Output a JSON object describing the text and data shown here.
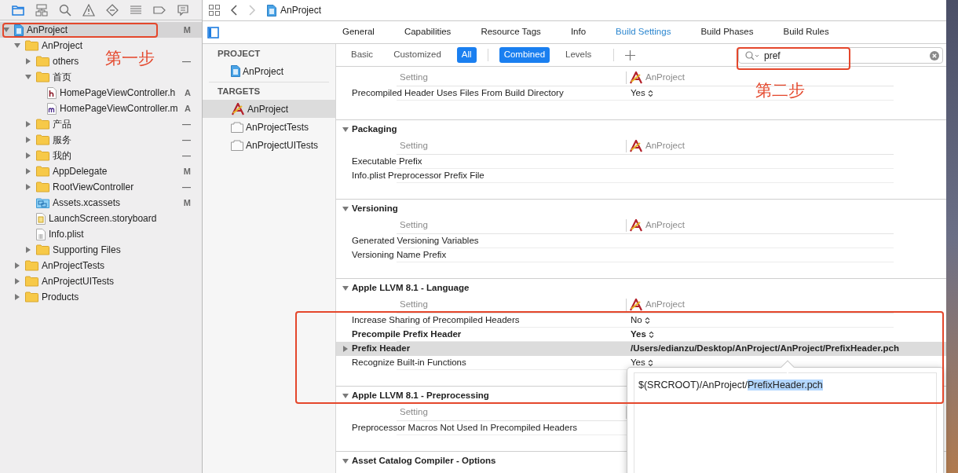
{
  "navigator_tabs": [
    {
      "kind": "folder",
      "selected": true
    },
    {
      "kind": "hierarchy",
      "selected": false
    },
    {
      "kind": "search",
      "selected": false
    },
    {
      "kind": "warning",
      "selected": false
    },
    {
      "kind": "diamond",
      "selected": false
    },
    {
      "kind": "list",
      "selected": false
    },
    {
      "kind": "tag",
      "selected": false
    },
    {
      "kind": "comment",
      "selected": false
    }
  ],
  "file_tree": [
    {
      "label": "AnProject",
      "kind": "project",
      "expanded": true,
      "selected": true,
      "badge": "M",
      "children": [
        {
          "label": "AnProject",
          "kind": "folder",
          "expanded": true,
          "selected": false,
          "children": [
            {
              "label": "others",
              "kind": "folder",
              "expanded": false,
              "selected": false,
              "badge": "—"
            },
            {
              "label": "首页",
              "kind": "folder",
              "expanded": true,
              "selected": false,
              "children": [
                {
                  "label": "HomePageViewController.h",
                  "kind": "header",
                  "selected": false,
                  "badge": "A"
                },
                {
                  "label": "HomePageViewController.m",
                  "kind": "source",
                  "selected": false,
                  "badge": "A"
                }
              ]
            },
            {
              "label": "产品",
              "kind": "folder",
              "expanded": false,
              "selected": false,
              "badge": "—"
            },
            {
              "label": "服务",
              "kind": "folder",
              "expanded": false,
              "selected": false,
              "badge": "—"
            },
            {
              "label": "我的",
              "kind": "folder",
              "expanded": false,
              "selected": false,
              "badge": "—"
            },
            {
              "label": "AppDelegate",
              "kind": "folder",
              "expanded": false,
              "selected": false,
              "badge": "M"
            },
            {
              "label": "RootViewController",
              "kind": "folder",
              "expanded": false,
              "selected": false,
              "badge": "—"
            },
            {
              "label": "Assets.xcassets",
              "kind": "assets",
              "selected": false,
              "badge": "M"
            },
            {
              "label": "LaunchScreen.storyboard",
              "kind": "storyboard",
              "selected": false
            },
            {
              "label": "Info.plist",
              "kind": "plist",
              "selected": false
            },
            {
              "label": "Supporting Files",
              "kind": "folder",
              "expanded": false,
              "selected": false
            }
          ]
        },
        {
          "label": "AnProjectTests",
          "kind": "folder",
          "expanded": false,
          "selected": false
        },
        {
          "label": "AnProjectUITests",
          "kind": "folder",
          "expanded": false,
          "selected": false
        },
        {
          "label": "Products",
          "kind": "folder",
          "expanded": false,
          "selected": false
        }
      ]
    }
  ],
  "jump_bar": {
    "nav_buttons": [
      {
        "kind": "back",
        "disabled": false
      },
      {
        "kind": "forward",
        "disabled": true
      }
    ],
    "breadcrumb": "AnProject"
  },
  "tabs": [
    {
      "label": "General",
      "selected": false
    },
    {
      "label": "Capabilities",
      "selected": false
    },
    {
      "label": "Resource Tags",
      "selected": false
    },
    {
      "label": "Info",
      "selected": false
    },
    {
      "label": "Build Settings",
      "selected": true
    },
    {
      "label": "Build Phases",
      "selected": false
    },
    {
      "label": "Build Rules",
      "selected": false
    }
  ],
  "targets_panel": [
    {
      "heading": "PROJECT",
      "items": [
        {
          "label": "AnProject",
          "kind": "project",
          "selected": false
        }
      ]
    },
    {
      "heading": "TARGETS",
      "items": [
        {
          "label": "AnProject",
          "kind": "app",
          "selected": true
        },
        {
          "label": "AnProjectTests",
          "kind": "bundle",
          "selected": false
        },
        {
          "label": "AnProjectUITests",
          "kind": "bundle",
          "selected": false
        }
      ]
    }
  ],
  "filter_bar": {
    "scope": [
      {
        "label": "Basic",
        "selected": false
      },
      {
        "label": "Customized",
        "selected": false
      },
      {
        "label": "All",
        "selected": true
      }
    ],
    "view": [
      {
        "label": "Combined",
        "selected": true
      },
      {
        "label": "Levels",
        "selected": false
      }
    ],
    "search": {
      "value": "pref"
    }
  },
  "settings_sections": [
    {
      "column_header": "Setting",
      "target": "AnProject",
      "rows": [
        {
          "name": "Precompiled Header Uses Files From Build Directory",
          "value": "Yes",
          "stepper": true,
          "customized": false,
          "selected": false
        }
      ]
    },
    {
      "title": "Packaging",
      "expanded": true,
      "column_header": "Setting",
      "target": "AnProject",
      "rows": [
        {
          "name": "Executable Prefix",
          "customized": false,
          "selected": false
        },
        {
          "name": "Info.plist Preprocessor Prefix File",
          "customized": false,
          "selected": false
        }
      ]
    },
    {
      "title": "Versioning",
      "expanded": true,
      "column_header": "Setting",
      "target": "AnProject",
      "rows": [
        {
          "name": "Generated Versioning Variables",
          "customized": false,
          "selected": false
        },
        {
          "name": "Versioning Name Prefix",
          "customized": false,
          "selected": false
        }
      ]
    },
    {
      "title": "Apple LLVM 8.1 - Language",
      "expanded": true,
      "column_header": "Setting",
      "target": "AnProject",
      "rows": [
        {
          "name": "Increase Sharing of Precompiled Headers",
          "value": "No",
          "stepper": true,
          "customized": false,
          "selected": false
        },
        {
          "name": "Precompile Prefix Header",
          "value": "Yes",
          "stepper": true,
          "customized": true,
          "selected": false
        },
        {
          "name": "Prefix Header",
          "value": "/Users/edianzu/Desktop/AnProject/AnProject/PrefixHeader.pch",
          "stepper": false,
          "customized": true,
          "selected": true,
          "expanded": false
        },
        {
          "name": "Recognize Built-in Functions",
          "value": "Yes",
          "stepper": true,
          "customized": false,
          "selected": false
        }
      ]
    },
    {
      "title": "Apple LLVM 8.1 - Preprocessing",
      "expanded": true,
      "column_header": "Setting",
      "rows": [
        {
          "name": "Preprocessor Macros Not Used In Precompiled Headers",
          "customized": false,
          "selected": false
        }
      ]
    },
    {
      "title": "Asset Catalog Compiler - Options",
      "expanded": true
    }
  ],
  "value_editor": {
    "prefix": "$(SRCROOT)/AnProject/",
    "selected_text": "PrefixHeader.pch"
  },
  "annotations": [
    "第一步",
    "第二步"
  ]
}
